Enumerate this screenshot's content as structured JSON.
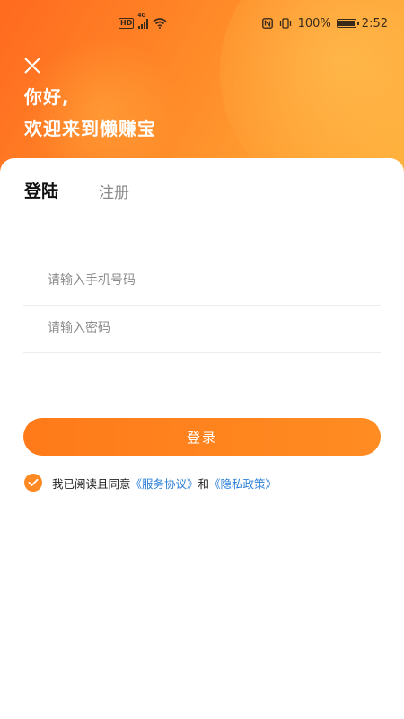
{
  "status_bar": {
    "hd_badge": "HD",
    "network": "4G",
    "battery_text": "100%",
    "time": "2:52",
    "battery_level": 1.0
  },
  "header": {
    "greeting_line1": "你好,",
    "greeting_line2": "欢迎来到懒赚宝",
    "close_icon": "close-icon"
  },
  "tabs": {
    "login": "登陆",
    "register": "注册"
  },
  "form": {
    "phone_placeholder": "请输入手机号码",
    "phone_value": "",
    "password_placeholder": "请输入密码",
    "password_value": ""
  },
  "login_button": "登录",
  "agreement": {
    "checked": true,
    "prefix": "我已阅读且同意",
    "service_link": "《服务协议》",
    "conjunction": "和",
    "privacy_link": "《隐私政策》"
  },
  "colors": {
    "primary": "#ff8a24",
    "link": "#2b7fd8"
  }
}
